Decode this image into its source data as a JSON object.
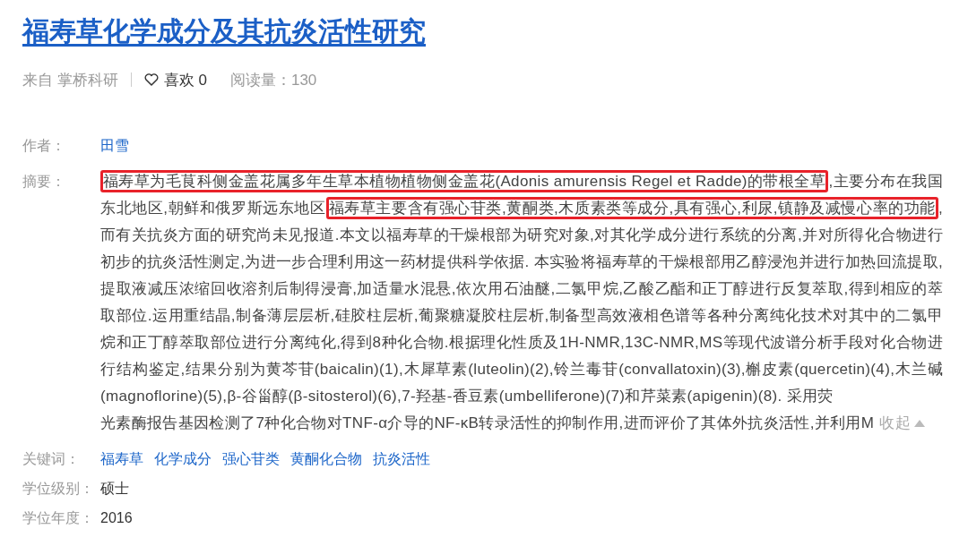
{
  "title": "福寿草化学成分及其抗炎活性研究",
  "meta": {
    "source": "来自 掌桥科研",
    "likes": "喜欢 0",
    "reads": "阅读量：130"
  },
  "author": {
    "label": "作者：",
    "value": "田雪"
  },
  "abstract": {
    "label": "摘要：",
    "segments": [
      {
        "text": "福寿草为毛茛科侧金盖花属多年生草本植物植物侧金盖花(Adonis amurensis Regel et Radde)的带根全草",
        "highlighted": true
      },
      {
        "text": ",主要分布在我国东北地区,朝鲜和俄罗斯远东地区",
        "highlighted": false
      },
      {
        "text": "福寿草主要含有强心苷类,黄酮类,木质素类等成分,具有强心,利尿,镇静及减慢心率的功能",
        "highlighted": true
      },
      {
        "text": ",而有关抗炎方面的研究尚未见报道.本文以福寿草的干燥根部为研究对象,对其化学成分进行系统的分离,并对所得化合物进行初步的抗炎活性测定,为进一步合理利用这一药材提供科学依据. 本实验将福寿草的干燥根部用乙醇浸泡并进行加热回流提取,提取液减压浓缩回收溶剂后制得浸膏,加适量水混悬,依次用石油醚,二氯甲烷,乙酸乙酯和正丁醇进行反复萃取,得到相应的萃取部位.运用重结晶,制备薄层层析,硅胶柱层析,葡聚糖凝胶柱层析,制备型高效液相色谱等各种分离纯化技术对其中的二氯甲烷和正丁醇萃取部位进行分离纯化,得到8种化合物.根据理化性质及1H-NMR,13C-NMR,MS等现代波谱分析手段对化合物进行结构鉴定,结果分别为黄芩苷(baicalin)(1),木犀草素(luteolin)(2),铃兰毒苷(convallatoxin)(3),槲皮素(quercetin)(4),木兰碱(magnoflorine)(5),β-谷甾醇(β-sitosterol)(6),7-羟基-香豆素(umbelliferone)(7)和芹菜素(apigenin)(8). 采用荧",
        "highlighted": false
      }
    ],
    "last_line": "光素酶报告基因检测了7种化合物对TNF-α介导的NF-κB转录活性的抑制作用,进而评价了其体外抗炎活性,并利用M",
    "toggle": "收起"
  },
  "keywords": {
    "label": "关键词：",
    "items": [
      "福寿草",
      "化学成分",
      "强心苷类",
      "黄酮化合物",
      "抗炎活性"
    ]
  },
  "degree": {
    "label": "学位级别：",
    "value": "硕士"
  },
  "year": {
    "label": "学位年度：",
    "value": "2016"
  }
}
